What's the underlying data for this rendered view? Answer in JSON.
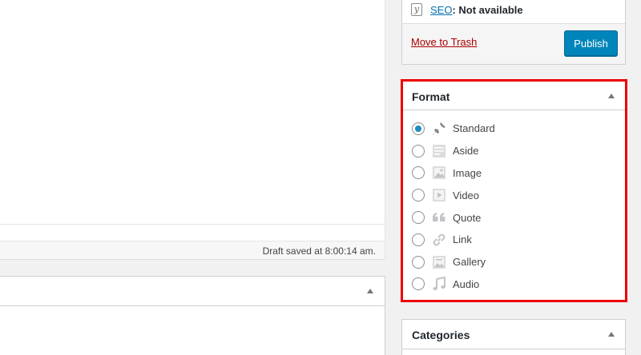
{
  "editor": {
    "status_text": "Draft saved at 8:00:14 am."
  },
  "publish": {
    "seo_link": "SEO",
    "seo_status": ": Not available",
    "trash_label": "Move to Trash",
    "publish_label": "Publish"
  },
  "format": {
    "title": "Format",
    "selected": "Standard",
    "options": [
      {
        "label": "Standard",
        "icon": "pin-icon"
      },
      {
        "label": "Aside",
        "icon": "aside-icon"
      },
      {
        "label": "Image",
        "icon": "image-icon"
      },
      {
        "label": "Video",
        "icon": "video-icon"
      },
      {
        "label": "Quote",
        "icon": "quote-icon"
      },
      {
        "label": "Link",
        "icon": "link-icon"
      },
      {
        "label": "Gallery",
        "icon": "gallery-icon"
      },
      {
        "label": "Audio",
        "icon": "audio-icon"
      }
    ],
    "highlight_color": "#e00000"
  },
  "categories": {
    "title": "Categories"
  },
  "colors": {
    "primary_button": "#0085ba",
    "link": "#0073aa",
    "trash": "#aa0000",
    "radio_checked": "#1e8cbe"
  }
}
